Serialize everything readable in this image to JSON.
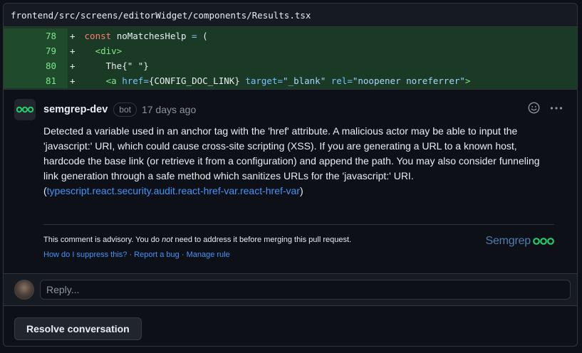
{
  "file": {
    "path": "frontend/src/screens/editorWidget/components/Results.tsx"
  },
  "diff": {
    "lines": [
      {
        "num": "78",
        "sign": "+",
        "tokens": [
          [
            "kw",
            " const "
          ],
          [
            "fn",
            "noMatchesHelp "
          ],
          [
            "op",
            "= "
          ],
          [
            "fn",
            "("
          ]
        ]
      },
      {
        "num": "79",
        "sign": "+",
        "tokens": [
          [
            "fn",
            "   "
          ],
          [
            "tag",
            "<div>"
          ]
        ]
      },
      {
        "num": "80",
        "sign": "+",
        "tokens": [
          [
            "fn",
            "     The{\" \"}"
          ]
        ]
      },
      {
        "num": "81",
        "sign": "+",
        "tokens": [
          [
            "fn",
            "     "
          ],
          [
            "tag",
            "<a "
          ],
          [
            "attr",
            "href="
          ],
          [
            "fn",
            "{CONFIG_DOC_LINK} "
          ],
          [
            "attr",
            "target="
          ],
          [
            "str",
            "\"_blank\" "
          ],
          [
            "attr",
            "rel="
          ],
          [
            "str",
            "\"noopener noreferrer\""
          ],
          [
            "tag",
            ">"
          ]
        ]
      }
    ]
  },
  "comment": {
    "author": "semgrep-dev",
    "badge": "bot",
    "time": "17 days ago",
    "body": "Detected a variable used in an anchor tag with the 'href' attribute. A malicious actor may be able to input the 'javascript:' URI, which could cause cross-site scripting (XSS). If you are generating a URL to a known host, hardcode the base link (or retrieve it from a configuration) and append the path. You may also consider funneling link generation through a safe method which sanitizes URLs for the 'javascript:' URI.",
    "rule_open": "(",
    "rule_link": "typescript.react.security.audit.react-href-var.react-href-var",
    "rule_close": ")",
    "advisory_pre": "This comment is advisory. You do ",
    "advisory_em": "not",
    "advisory_post": " need to address it before merging this pull request.",
    "links": [
      "How do I suppress this?",
      "Report a bug",
      "Manage rule"
    ],
    "link_sep": " · ",
    "brand": "Semgrep",
    "brand_color": "#4f7db0",
    "brand_mark_color": "#23c96b"
  },
  "reply": {
    "placeholder": "Reply..."
  },
  "resolve": {
    "label": "Resolve conversation"
  },
  "icons": {
    "emoji": "smiley-icon",
    "more": "kebab-icon"
  }
}
